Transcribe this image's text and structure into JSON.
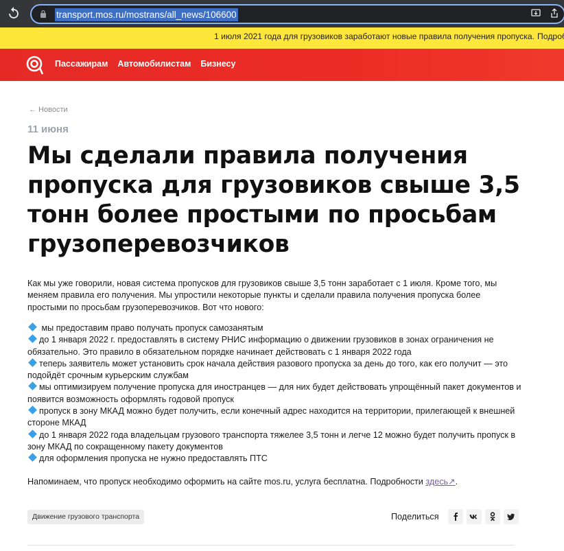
{
  "browser": {
    "url": "transport.mos.ru/mostrans/all_news/106600",
    "back_icon": "arrow-left-icon",
    "lock_icon": "lock-icon",
    "omni_icons": [
      "install-app-icon",
      "share-icon"
    ]
  },
  "banner": {
    "text": "1 июля 2021 года для грузовиков заработают новые правила получения пропуска.",
    "more": "Подробнее"
  },
  "nav": {
    "items": [
      "Пассажирам",
      "Автомобилистам",
      "Бизнесу"
    ],
    "logo_icon": "moscow-transport-logo-icon"
  },
  "article": {
    "back_link": "← Новости",
    "date": "11 июня",
    "title": "Мы сделали правила получения пропуска для грузовиков свыше 3,5 тонн более простыми по просьбам грузоперевозчиков",
    "intro": "Как мы уже говорили, новая система пропусков для грузовиков свыше 3,5 тонн заработает с 1 июля. Кроме того, мы меняем правила его получения. Мы упростили некоторые пункты и сделали правила получения пропуска более простыми по просьбам грузоперевозчиков. Вот что нового:",
    "list": [
      " мы предоставим право получать пропуск самозанятым",
      "до 1 января 2022 г. предоставлять в систему РНИС информацию о движении грузовиков в зонах ограничения не обязательно. Это правило в обязательном порядке начинает действовать с 1 января 2022 года",
      "теперь заявитель может установить срок начала действия разового пропуска за день до того, как его получит — это подойдёт срочным курьерским службам",
      "мы оптимизируем получение пропуска для иностранцев — для них будет действовать упрощённый пакет документов и появится возможность оформлять годовой пропуск",
      "пропуск в зону МКАД можно будет получить, если конечный адрес находится на территории, прилегающей к внешней стороне МКАД",
      "до 1 января 2022 года владельцам грузового транспорта тяжелее 3,5 тонн и легче 12 можно будет получить пропуск в зону МКАД по сокращенному пакету документов",
      "для оформления пропуска не нужно предоставлять ПТС"
    ],
    "reminder_text": "Напоминаем, что пропуск необходимо оформить на сайте mos.ru, услуга бесплатна. Подробности ",
    "reminder_link": "здесь↗",
    "reminder_end": ".",
    "tag": "Движение грузового транспорта",
    "share_label": "Поделиться",
    "share_buttons": [
      {
        "label": "f",
        "icon": "facebook-icon"
      },
      {
        "label": "vk",
        "icon": "vk-icon"
      },
      {
        "label": "ok",
        "icon": "odnoklassniki-icon"
      },
      {
        "label": "tw",
        "icon": "twitter-icon"
      }
    ],
    "list_marker_color": "#3aa0e8",
    "accent_red": "#e52a25",
    "banner_yellow": "#ffe63b"
  }
}
